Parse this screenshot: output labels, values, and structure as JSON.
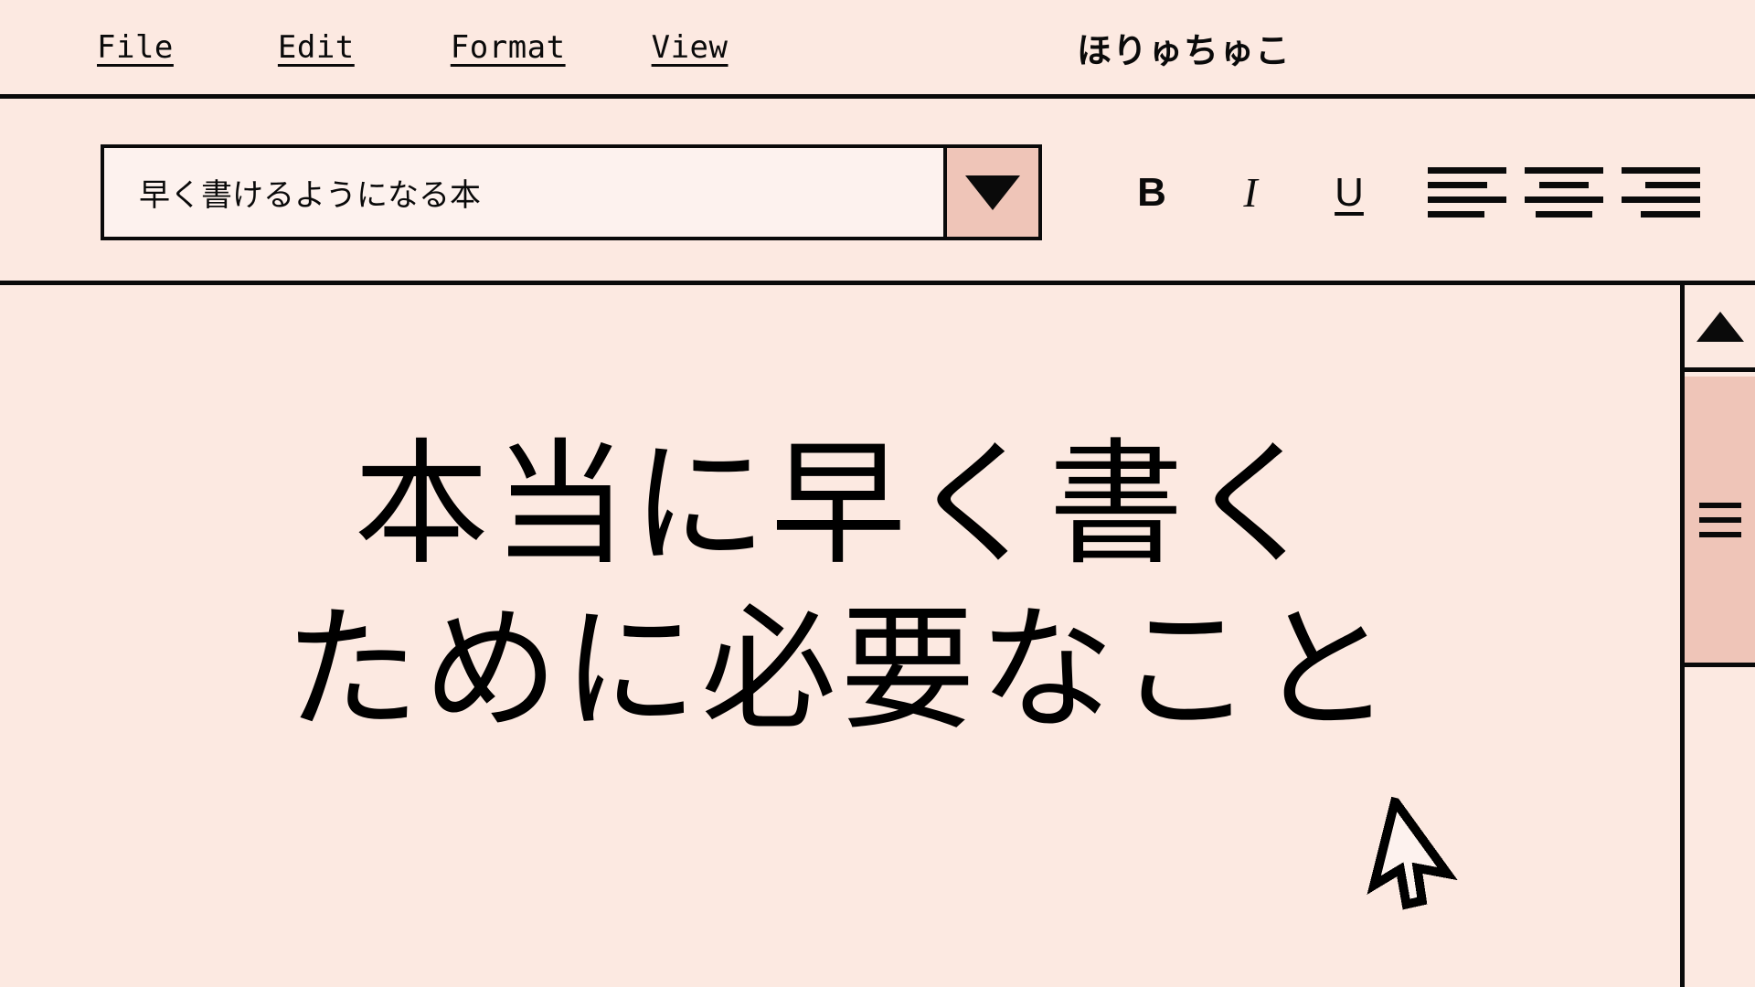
{
  "app": {
    "background_color": "#fce9e1",
    "accent_color": "#efc5b8",
    "field_color": "#fdf2ee",
    "line_color": "#0a0a0a"
  },
  "menubar": {
    "items": [
      {
        "label": "File"
      },
      {
        "label": "Edit"
      },
      {
        "label": "Format"
      },
      {
        "label": "View"
      }
    ],
    "brand": "ほりゅちゅこ"
  },
  "toolbar": {
    "document_select": {
      "value": "早く書けるようになる本",
      "arrow_icon": "triangle-down-icon"
    },
    "format_buttons": [
      {
        "name": "bold",
        "label": "B"
      },
      {
        "name": "italic",
        "label": "I"
      },
      {
        "name": "underline",
        "label": "U"
      }
    ],
    "align_buttons": [
      {
        "name": "align-left",
        "icon": "align-left-icon"
      },
      {
        "name": "align-center",
        "icon": "align-center-icon"
      },
      {
        "name": "align-right",
        "icon": "align-right-icon"
      }
    ]
  },
  "document": {
    "heading": "本当に早く書く\nために必要なこと",
    "heading_lines": [
      "本当に早く書く",
      "ために必要なこと"
    ]
  },
  "scrollbar": {
    "up_arrow_icon": "triangle-up-icon",
    "thumb_grip_icon": "grip-lines-icon"
  },
  "pointer": {
    "icon": "mouse-arrow-cursor"
  }
}
